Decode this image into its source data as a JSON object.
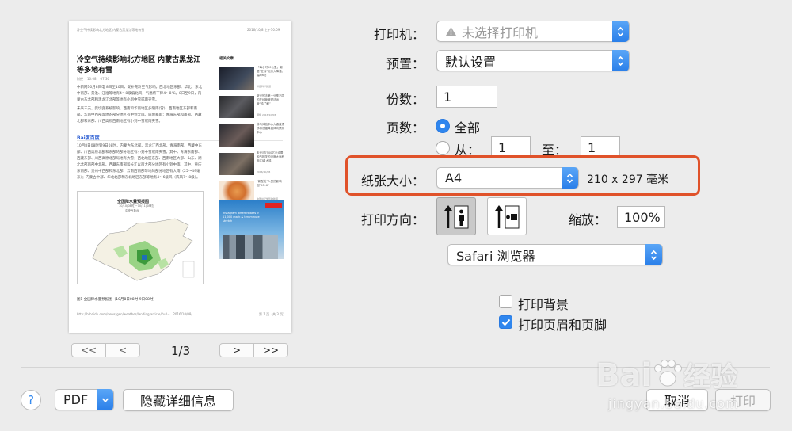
{
  "preview": {
    "header_left": "冷空气持续影响北方地区 内蒙古黑龙江等地有雪",
    "header_right": "2016/10/8 上午10:09",
    "article_title": "冷空气持续影响北方地区 内蒙古黑龙江等多地有雪",
    "meta_source": "财经",
    "meta_time": "10:08",
    "meta_time2": "07:30",
    "para1": "中新网10月8日电 8日至10日，受补充冷空气影响，西北地区东部、华北、东北中南部、黄淮、江淮等地有4～8级偏北风，气温将下降4～8℃。8日至9日，内蒙古东北部和黑龙江北部等地有小到中雪或雨夹雪。",
    "para2": "未来三天，受切变系统影响，西南和华南地区多阴雨(雪)，西南地区东部和南部、华南中西部等地的部分地区有中到大雨。局地暴雨；青海东部和南部、西藏北部和东部、川西高原西南地区有小到中雪或雨夹雪。",
    "para3": "10月8日08时到9日08时，内蒙古东北部、黑龙江西北部、青海南部、西藏中东部、川西高原北部和东部的部分地区有小到中雪或雨夹雪。其中，青海东南部、西藏东部、川西高原北部局地有大雪；西北地区东部、西南地区大部、山东、湖北北部南部中北部、西藏东南部和长江以南大部分地区有小到中雨。其中，重庆东南部、贵州中西部和东北部、云南西南部等地的部分地区有大雨（25～49毫米）；内蒙古中部、华北北部和东北地区东部等地有4～6级风（阵风7～8级）。",
    "baidu_logo": "Bai度百度",
    "map_title": "全国降水量预报图",
    "map_date": "10/10(08时)~10/11(08时)",
    "map_source": "中央气象台",
    "map_caption": "图1 全国降水量预报图（10月8日08时-9日08时）",
    "sidebar_title": "相关文章",
    "side_items": [
      {
        "text": "「每小时50公里」潮湿“狂涛”北方大降温，幅8/6日",
        "meta": "详细科学频道"
      },
      {
        "text": "新兴的法第十分享不同的在经营管理法运营“给了解”",
        "meta": "网络 2016/10/08"
      },
      {
        "text": "非与体验中心大通道漂移和低温降温风向预测中心",
        "meta": ""
      },
      {
        "text": "未来这7500亿元设置和气相关的深度大面积多区域 大风",
        "meta": "2016/10/08"
      },
      {
        "text": "“新型社”人员的影响因\"2016\"",
        "meta": "中国共产党影响新闻  10:27"
      }
    ],
    "ad_text": "Instagram differentiates > 11,000 mark & ten-minute stretch",
    "footer_url": "http://b.baidu.com/news/gen/weather/landing/article/?url=...2016/10/08/...",
    "footer_page": "第 1 页（共 3 页）",
    "nav_first": "<<",
    "nav_prev": "<",
    "page_indicator": "1/3",
    "nav_next": ">",
    "nav_last": ">>"
  },
  "settings": {
    "printer_label": "打印机：",
    "printer_value": "未选择打印机",
    "preset_label": "预置：",
    "preset_value": "默认设置",
    "copies_label": "份数：",
    "copies_value": "1",
    "pages_label": "页数：",
    "pages_all": "全部",
    "pages_from": "从：",
    "pages_from_value": "1",
    "pages_to": "至：",
    "pages_to_value": "1",
    "paper_label": "纸张大小：",
    "paper_value": "A4",
    "paper_dims": "210 x 297 毫米",
    "orientation_label": "打印方向：",
    "scale_label": "缩放：",
    "scale_value": "100%",
    "section_value": "Safari 浏览器",
    "print_bg": "打印背景",
    "print_headers": "打印页眉和页脚"
  },
  "footer": {
    "help": "?",
    "pdf": "PDF",
    "hide_details": "隐藏详细信息",
    "cancel": "取消",
    "print": "打印"
  },
  "watermark": {
    "brand": "Bai",
    "brand2": "经验",
    "url": "jingyan.baidu.com"
  },
  "colors": {
    "accent": "#2f86ee",
    "highlight": "#e0522a"
  }
}
